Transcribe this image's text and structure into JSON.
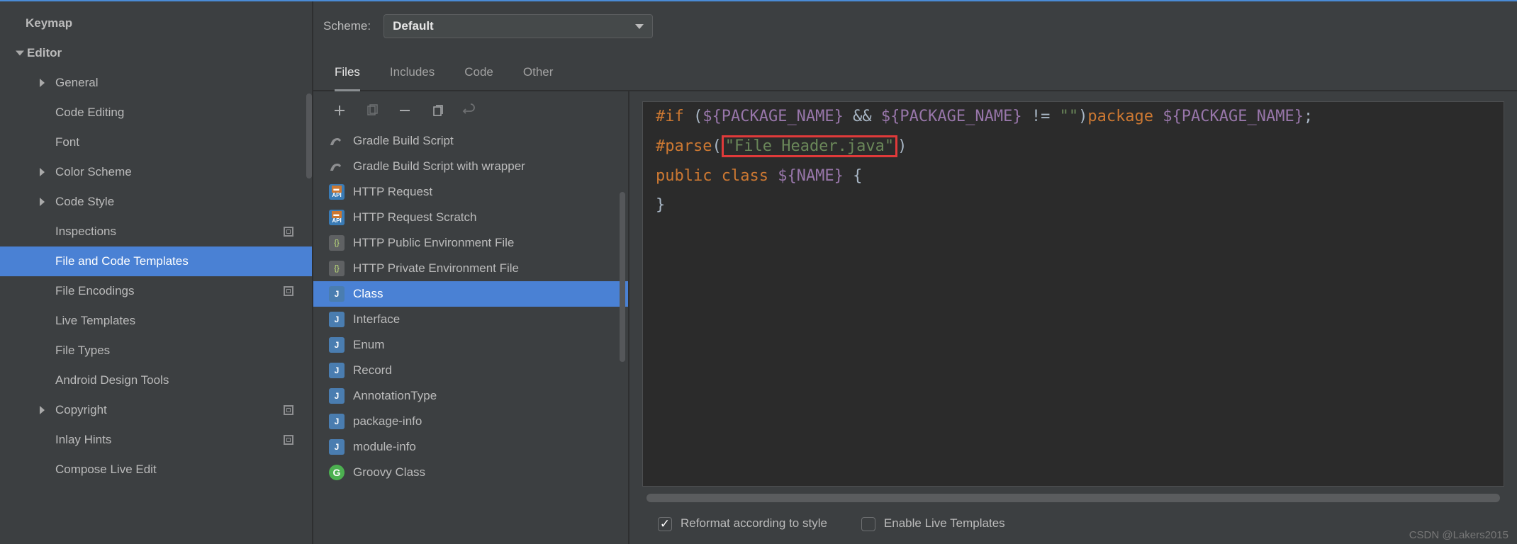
{
  "sidebar": {
    "items": [
      {
        "label": "Keymap",
        "kind": "root"
      },
      {
        "label": "Editor",
        "kind": "root-exp"
      },
      {
        "label": "General",
        "kind": "sub-arrow"
      },
      {
        "label": "Code Editing",
        "kind": "sub"
      },
      {
        "label": "Font",
        "kind": "sub"
      },
      {
        "label": "Color Scheme",
        "kind": "sub-arrow"
      },
      {
        "label": "Code Style",
        "kind": "sub-arrow"
      },
      {
        "label": "Inspections",
        "kind": "sub",
        "pin": true
      },
      {
        "label": "File and Code Templates",
        "kind": "sub",
        "selected": true
      },
      {
        "label": "File Encodings",
        "kind": "sub",
        "pin": true
      },
      {
        "label": "Live Templates",
        "kind": "sub"
      },
      {
        "label": "File Types",
        "kind": "sub"
      },
      {
        "label": "Android Design Tools",
        "kind": "sub"
      },
      {
        "label": "Copyright",
        "kind": "sub-arrow",
        "pin": true
      },
      {
        "label": "Inlay Hints",
        "kind": "sub",
        "pin": true
      },
      {
        "label": "Compose Live Edit",
        "kind": "sub"
      }
    ]
  },
  "scheme": {
    "label": "Scheme:",
    "value": "Default"
  },
  "tabs": [
    "Files",
    "Includes",
    "Code",
    "Other"
  ],
  "activeTab": 0,
  "templates": [
    {
      "label": "Gradle Build Script",
      "icon": "gradle"
    },
    {
      "label": "Gradle Build Script with wrapper",
      "icon": "gradle"
    },
    {
      "label": "HTTP Request",
      "icon": "api"
    },
    {
      "label": "HTTP Request Scratch",
      "icon": "api"
    },
    {
      "label": "HTTP Public Environment File",
      "icon": "env"
    },
    {
      "label": "HTTP Private Environment File",
      "icon": "env"
    },
    {
      "label": "Class",
      "icon": "java",
      "selected": true
    },
    {
      "label": "Interface",
      "icon": "java"
    },
    {
      "label": "Enum",
      "icon": "java"
    },
    {
      "label": "Record",
      "icon": "java"
    },
    {
      "label": "AnnotationType",
      "icon": "java"
    },
    {
      "label": "package-info",
      "icon": "java"
    },
    {
      "label": "module-info",
      "icon": "java"
    },
    {
      "label": "Groovy Class",
      "icon": "groovy"
    }
  ],
  "code": {
    "if": "#if ",
    "lp": "(",
    "v1": "${PACKAGE_NAME}",
    "and": " && ",
    "v2": "${PACKAGE_NAME}",
    "neq": " != ",
    "empty": "\"\"",
    "rp": ")",
    "pkg": "package ",
    "v3": "${PACKAGE_NAME}",
    "semi": ";",
    "parse": "#parse",
    "lp2": "(",
    "fh": "\"File Header.java\"",
    "rp2": ")",
    "pub": "public ",
    "cls": "class ",
    "name": "${NAME}",
    "ob": " {",
    "cb": "}"
  },
  "checkboxes": {
    "reformat": "Reformat according to style",
    "live": "Enable Live Templates"
  },
  "watermark": "CSDN @Lakers2015"
}
